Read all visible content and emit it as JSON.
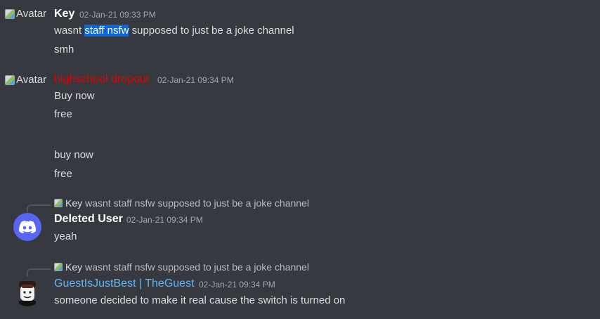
{
  "messages": [
    {
      "avatar_alt": "Avatar",
      "author": "Key",
      "timestamp": "02-Jan-21 09:33 PM",
      "lines": {
        "line1_pre": "wasnt ",
        "line1_highlight": "staff nsfw",
        "line1_post": " supposed to just be a joke channel",
        "line2": "smh"
      }
    },
    {
      "avatar_alt": "Avatar",
      "author": "highschool dropout",
      "author_color": "#e60000",
      "timestamp": "02-Jan-21 09:34 PM",
      "lines": [
        "Buy now",
        "free",
        "buy now",
        "free"
      ]
    },
    {
      "reply": {
        "avatar_alt": "Avatar",
        "author": "Key",
        "text": "wasnt staff nsfw supposed to just be a joke channel"
      },
      "avatar_icon": "discord-logo-icon",
      "author": "Deleted User",
      "timestamp": "02-Jan-21 09:34 PM",
      "lines": [
        "yeah"
      ]
    },
    {
      "reply": {
        "avatar_alt": "Avatar",
        "author": "Key",
        "text": "wasnt staff nsfw supposed to just be a joke channel"
      },
      "avatar_icon": "roblox-avatar-icon",
      "author": "GuestIsJustBest | TheGuest",
      "author_color": "#5cb8ff",
      "timestamp": "02-Jan-21 09:34 PM",
      "lines": [
        "someone decided to make it real cause the switch is turned on"
      ]
    }
  ],
  "colors": {
    "background": "#36393f",
    "text": "#dcddde",
    "highlight": "#0b66d6",
    "discord_blurple": "#5865f2"
  }
}
